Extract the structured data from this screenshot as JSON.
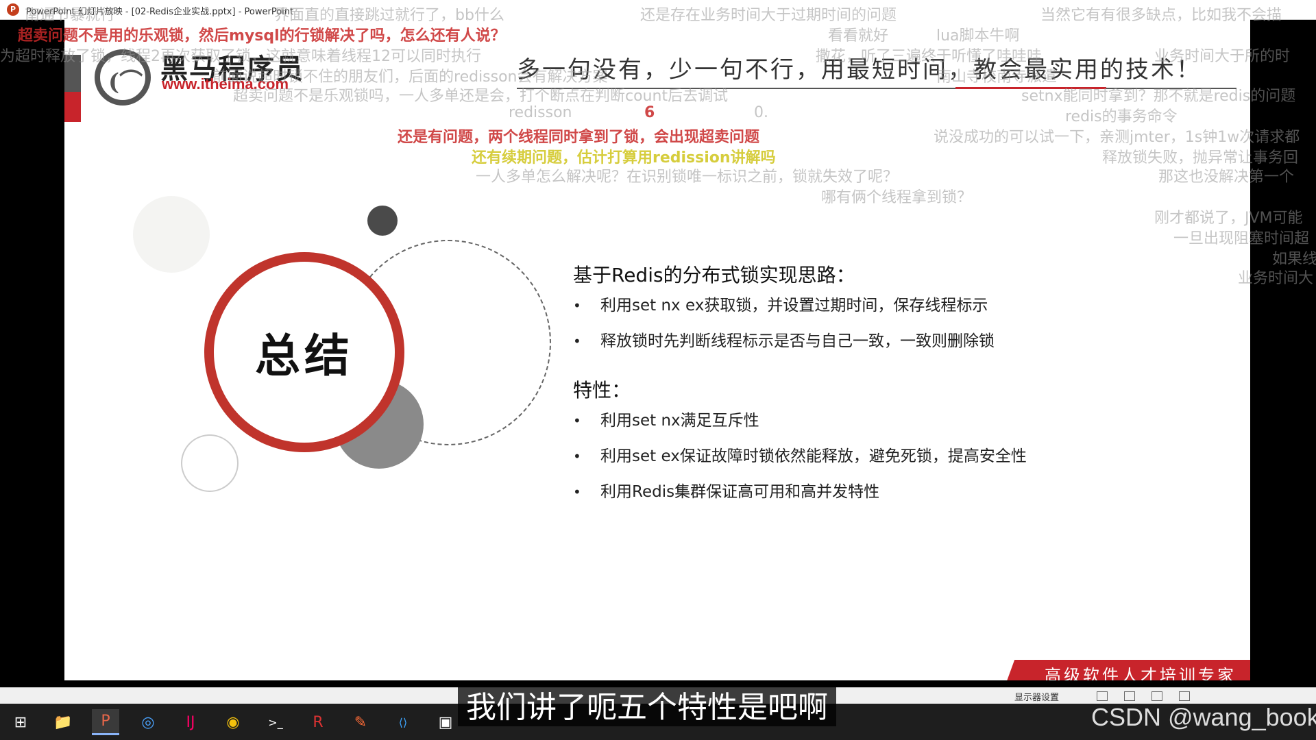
{
  "window": {
    "title": "PowerPoint 幻灯片放映 - [02-Redis企业实战.pptx] - PowerPoint",
    "app_icon_letter": "P"
  },
  "slide": {
    "logo_mark": "(⌒",
    "logo_text": "黑马程序员",
    "logo_url": "www.itheima.com",
    "slogan": "多一句没有，少一句不行，用最短时间，教会最实用的技术！",
    "summary_title": "总结",
    "sections": [
      {
        "title": "基于Redis的分布式锁实现思路：",
        "bullets": [
          "利用set nx ex获取锁，并设置过期时间，保存线程标示",
          "释放锁时先判断线程标示是否与自己一致，一致则删除锁"
        ]
      },
      {
        "title": "特性：",
        "bullets": [
          "利用set nx满足互斥性",
          "利用set ex保证故障时锁依然能释放，避免死锁，提高安全性",
          "利用Redis集群保证高可用和高并发特性"
        ]
      }
    ],
    "brand_tag": "高级软件人才培训专家",
    "accent_red": "#c8242b",
    "ring_red": "#c0342c"
  },
  "status_bar": {
    "display_setting": "显示器设置"
  },
  "taskbar": {
    "items": [
      {
        "name": "start-icon",
        "glyph": "⊞"
      },
      {
        "name": "file-explorer-icon",
        "glyph": "📁"
      },
      {
        "name": "powerpoint-icon",
        "glyph": "P"
      },
      {
        "name": "browser-icon",
        "glyph": "◎"
      },
      {
        "name": "intellij-icon",
        "glyph": "IJ"
      },
      {
        "name": "chrome-icon",
        "glyph": "◉"
      },
      {
        "name": "terminal-icon",
        "glyph": ">_"
      },
      {
        "name": "redis-app-icon",
        "glyph": "R"
      },
      {
        "name": "postman-icon",
        "glyph": "✎"
      },
      {
        "name": "vscode-icon",
        "glyph": "⟨⟩"
      },
      {
        "name": "image-viewer-icon",
        "glyph": "▣"
      }
    ]
  },
  "danmaku": [
    {
      "text": "南通节暴就行",
      "cls": "light"
    },
    {
      "text": "界面直的直接跳过就行了，bb什么",
      "cls": "light"
    },
    {
      "text": "还是存在业务时间大于过期时间的问题",
      "cls": "light"
    },
    {
      "text": "当然它有有很多缺点，比如我不会描",
      "cls": "light"
    },
    {
      "text": "超卖问题不是用的乐观锁，然后mysql的行锁解决了吗，怎么还有人说？",
      "cls": "red"
    },
    {
      "text": "看看就好",
      "cls": "light"
    },
    {
      "text": "lua脚本牛啊",
      "cls": "light"
    },
    {
      "text": "为超时释放了锁，线程2再次获取了锁，这就意味着线程12可以同时执行",
      "cls": "light"
    },
    {
      "text": "撒花，听了三遍终于听懂了哇哇哇",
      "cls": "light"
    },
    {
      "text": "业务时间大于所的时",
      "cls": "light"
    },
    {
      "text": "前面说超时锁不住的朋友们，后面的redisson会有解决方案",
      "cls": "light"
    },
    {
      "text": "南山寺校南寺派遣",
      "cls": "light"
    },
    {
      "text": "超卖问题不是乐观锁吗，一人多单还是会，打个断点在判断count后去调试",
      "cls": "light"
    },
    {
      "text": "setnx能同时拿到？那不就是redis的问题",
      "cls": "light"
    },
    {
      "text": "redisson",
      "cls": "light"
    },
    {
      "text": "6",
      "cls": "red"
    },
    {
      "text": "0.",
      "cls": "light"
    },
    {
      "text": "redis的事务命令",
      "cls": "light"
    },
    {
      "text": "还是有问题，两个线程同时拿到了锁，会出现超卖问题",
      "cls": "red"
    },
    {
      "text": "说没成功的可以试一下，亲测jmter，1s钟1w次请求都",
      "cls": "light"
    },
    {
      "text": "还有续期问题，估计打算用redission讲解吗",
      "cls": "yellow"
    },
    {
      "text": "释放锁失败，抛异常让事务回",
      "cls": "light"
    },
    {
      "text": "一人多单怎么解决呢？在识别锁唯一标识之前，锁就失效了呢？",
      "cls": "light"
    },
    {
      "text": "那这也没解决第一个",
      "cls": "light"
    },
    {
      "text": "哪有俩个线程拿到锁？",
      "cls": "light"
    },
    {
      "text": "刚才都说了，JVM可能",
      "cls": "light"
    },
    {
      "text": "一旦出现阻塞时间超",
      "cls": "light"
    },
    {
      "text": "如果线",
      "cls": "light"
    },
    {
      "text": "业务时间大",
      "cls": "light"
    }
  ],
  "subtitle": "我们讲了呃五个特性是吧啊",
  "watermark": "CSDN @wang_book"
}
